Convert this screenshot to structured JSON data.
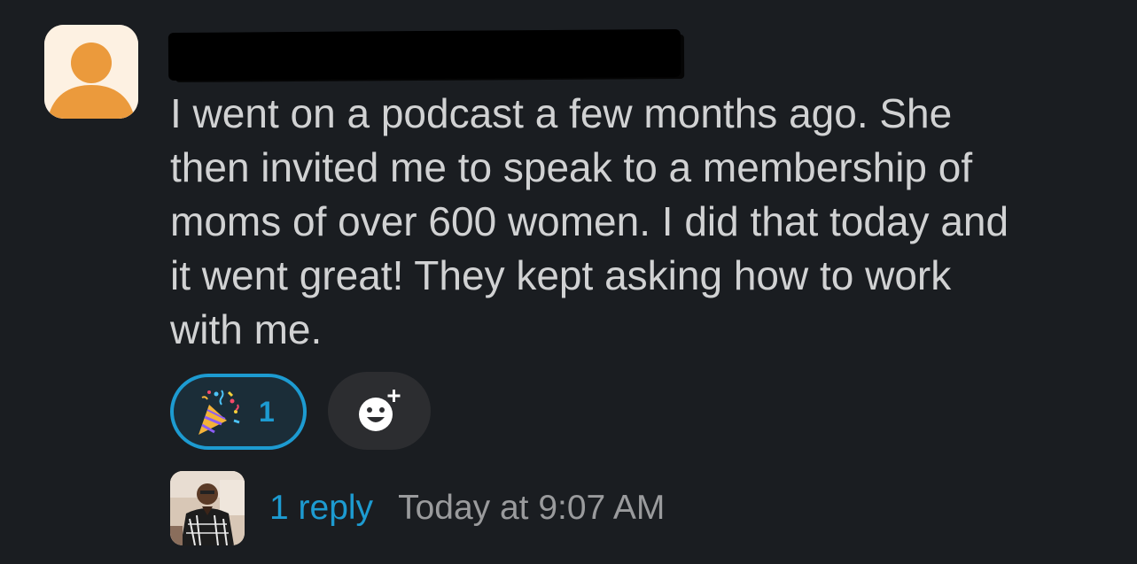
{
  "message": {
    "author": "",
    "text": "I went on a podcast a few months ago. She\nthen invited me to speak to a membership of\nmoms of over 600 women. I did that today and\nit went great! They kept asking how to work\nwith me.",
    "avatar_icon": "default-user-avatar-icon"
  },
  "reactions": [
    {
      "emoji_icon": "party-popper-icon",
      "count": "1",
      "reacted": true
    }
  ],
  "add_reaction_icon": "add-emoji-reaction-icon",
  "thread": {
    "reply_count_label": "1 reply",
    "timestamp": "Today at 9:07 AM",
    "replier_avatar_icon": "replier-photo-avatar"
  },
  "colors": {
    "background": "#1a1d21",
    "text": "#d1d2d3",
    "link": "#1d9bd1",
    "muted": "#9a9b9d",
    "avatar_orange": "#eb9a3c"
  }
}
